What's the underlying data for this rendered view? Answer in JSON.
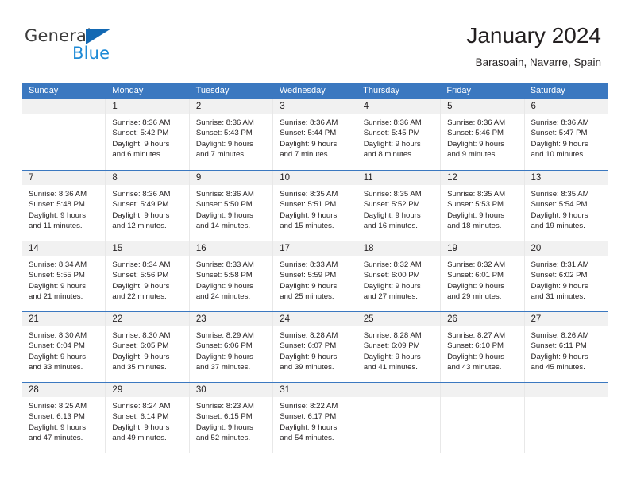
{
  "brand": {
    "name_part1": "General",
    "name_part2": "Blue",
    "triangle_color": "#1268b3",
    "blue_color": "#1e8ad6"
  },
  "header": {
    "title": "January 2024",
    "subtitle": "Barasoain, Navarre, Spain"
  },
  "theme": {
    "header_blue": "#3b78c0",
    "daynumber_band": "#f1f1f1",
    "cell_divider": "#e8e8e8",
    "text": "#231f20"
  },
  "weekdays": [
    "Sunday",
    "Monday",
    "Tuesday",
    "Wednesday",
    "Thursday",
    "Friday",
    "Saturday"
  ],
  "weeks": [
    [
      {
        "day": "",
        "sunrise": "",
        "sunset": "",
        "daylight": ""
      },
      {
        "day": "1",
        "sunrise": "Sunrise: 8:36 AM",
        "sunset": "Sunset: 5:42 PM",
        "daylight": "Daylight: 9 hours and 6 minutes."
      },
      {
        "day": "2",
        "sunrise": "Sunrise: 8:36 AM",
        "sunset": "Sunset: 5:43 PM",
        "daylight": "Daylight: 9 hours and 7 minutes."
      },
      {
        "day": "3",
        "sunrise": "Sunrise: 8:36 AM",
        "sunset": "Sunset: 5:44 PM",
        "daylight": "Daylight: 9 hours and 7 minutes."
      },
      {
        "day": "4",
        "sunrise": "Sunrise: 8:36 AM",
        "sunset": "Sunset: 5:45 PM",
        "daylight": "Daylight: 9 hours and 8 minutes."
      },
      {
        "day": "5",
        "sunrise": "Sunrise: 8:36 AM",
        "sunset": "Sunset: 5:46 PM",
        "daylight": "Daylight: 9 hours and 9 minutes."
      },
      {
        "day": "6",
        "sunrise": "Sunrise: 8:36 AM",
        "sunset": "Sunset: 5:47 PM",
        "daylight": "Daylight: 9 hours and 10 minutes."
      }
    ],
    [
      {
        "day": "7",
        "sunrise": "Sunrise: 8:36 AM",
        "sunset": "Sunset: 5:48 PM",
        "daylight": "Daylight: 9 hours and 11 minutes."
      },
      {
        "day": "8",
        "sunrise": "Sunrise: 8:36 AM",
        "sunset": "Sunset: 5:49 PM",
        "daylight": "Daylight: 9 hours and 12 minutes."
      },
      {
        "day": "9",
        "sunrise": "Sunrise: 8:36 AM",
        "sunset": "Sunset: 5:50 PM",
        "daylight": "Daylight: 9 hours and 14 minutes."
      },
      {
        "day": "10",
        "sunrise": "Sunrise: 8:35 AM",
        "sunset": "Sunset: 5:51 PM",
        "daylight": "Daylight: 9 hours and 15 minutes."
      },
      {
        "day": "11",
        "sunrise": "Sunrise: 8:35 AM",
        "sunset": "Sunset: 5:52 PM",
        "daylight": "Daylight: 9 hours and 16 minutes."
      },
      {
        "day": "12",
        "sunrise": "Sunrise: 8:35 AM",
        "sunset": "Sunset: 5:53 PM",
        "daylight": "Daylight: 9 hours and 18 minutes."
      },
      {
        "day": "13",
        "sunrise": "Sunrise: 8:35 AM",
        "sunset": "Sunset: 5:54 PM",
        "daylight": "Daylight: 9 hours and 19 minutes."
      }
    ],
    [
      {
        "day": "14",
        "sunrise": "Sunrise: 8:34 AM",
        "sunset": "Sunset: 5:55 PM",
        "daylight": "Daylight: 9 hours and 21 minutes."
      },
      {
        "day": "15",
        "sunrise": "Sunrise: 8:34 AM",
        "sunset": "Sunset: 5:56 PM",
        "daylight": "Daylight: 9 hours and 22 minutes."
      },
      {
        "day": "16",
        "sunrise": "Sunrise: 8:33 AM",
        "sunset": "Sunset: 5:58 PM",
        "daylight": "Daylight: 9 hours and 24 minutes."
      },
      {
        "day": "17",
        "sunrise": "Sunrise: 8:33 AM",
        "sunset": "Sunset: 5:59 PM",
        "daylight": "Daylight: 9 hours and 25 minutes."
      },
      {
        "day": "18",
        "sunrise": "Sunrise: 8:32 AM",
        "sunset": "Sunset: 6:00 PM",
        "daylight": "Daylight: 9 hours and 27 minutes."
      },
      {
        "day": "19",
        "sunrise": "Sunrise: 8:32 AM",
        "sunset": "Sunset: 6:01 PM",
        "daylight": "Daylight: 9 hours and 29 minutes."
      },
      {
        "day": "20",
        "sunrise": "Sunrise: 8:31 AM",
        "sunset": "Sunset: 6:02 PM",
        "daylight": "Daylight: 9 hours and 31 minutes."
      }
    ],
    [
      {
        "day": "21",
        "sunrise": "Sunrise: 8:30 AM",
        "sunset": "Sunset: 6:04 PM",
        "daylight": "Daylight: 9 hours and 33 minutes."
      },
      {
        "day": "22",
        "sunrise": "Sunrise: 8:30 AM",
        "sunset": "Sunset: 6:05 PM",
        "daylight": "Daylight: 9 hours and 35 minutes."
      },
      {
        "day": "23",
        "sunrise": "Sunrise: 8:29 AM",
        "sunset": "Sunset: 6:06 PM",
        "daylight": "Daylight: 9 hours and 37 minutes."
      },
      {
        "day": "24",
        "sunrise": "Sunrise: 8:28 AM",
        "sunset": "Sunset: 6:07 PM",
        "daylight": "Daylight: 9 hours and 39 minutes."
      },
      {
        "day": "25",
        "sunrise": "Sunrise: 8:28 AM",
        "sunset": "Sunset: 6:09 PM",
        "daylight": "Daylight: 9 hours and 41 minutes."
      },
      {
        "day": "26",
        "sunrise": "Sunrise: 8:27 AM",
        "sunset": "Sunset: 6:10 PM",
        "daylight": "Daylight: 9 hours and 43 minutes."
      },
      {
        "day": "27",
        "sunrise": "Sunrise: 8:26 AM",
        "sunset": "Sunset: 6:11 PM",
        "daylight": "Daylight: 9 hours and 45 minutes."
      }
    ],
    [
      {
        "day": "28",
        "sunrise": "Sunrise: 8:25 AM",
        "sunset": "Sunset: 6:13 PM",
        "daylight": "Daylight: 9 hours and 47 minutes."
      },
      {
        "day": "29",
        "sunrise": "Sunrise: 8:24 AM",
        "sunset": "Sunset: 6:14 PM",
        "daylight": "Daylight: 9 hours and 49 minutes."
      },
      {
        "day": "30",
        "sunrise": "Sunrise: 8:23 AM",
        "sunset": "Sunset: 6:15 PM",
        "daylight": "Daylight: 9 hours and 52 minutes."
      },
      {
        "day": "31",
        "sunrise": "Sunrise: 8:22 AM",
        "sunset": "Sunset: 6:17 PM",
        "daylight": "Daylight: 9 hours and 54 minutes."
      },
      {
        "day": "",
        "sunrise": "",
        "sunset": "",
        "daylight": ""
      },
      {
        "day": "",
        "sunrise": "",
        "sunset": "",
        "daylight": ""
      },
      {
        "day": "",
        "sunrise": "",
        "sunset": "",
        "daylight": ""
      }
    ]
  ]
}
